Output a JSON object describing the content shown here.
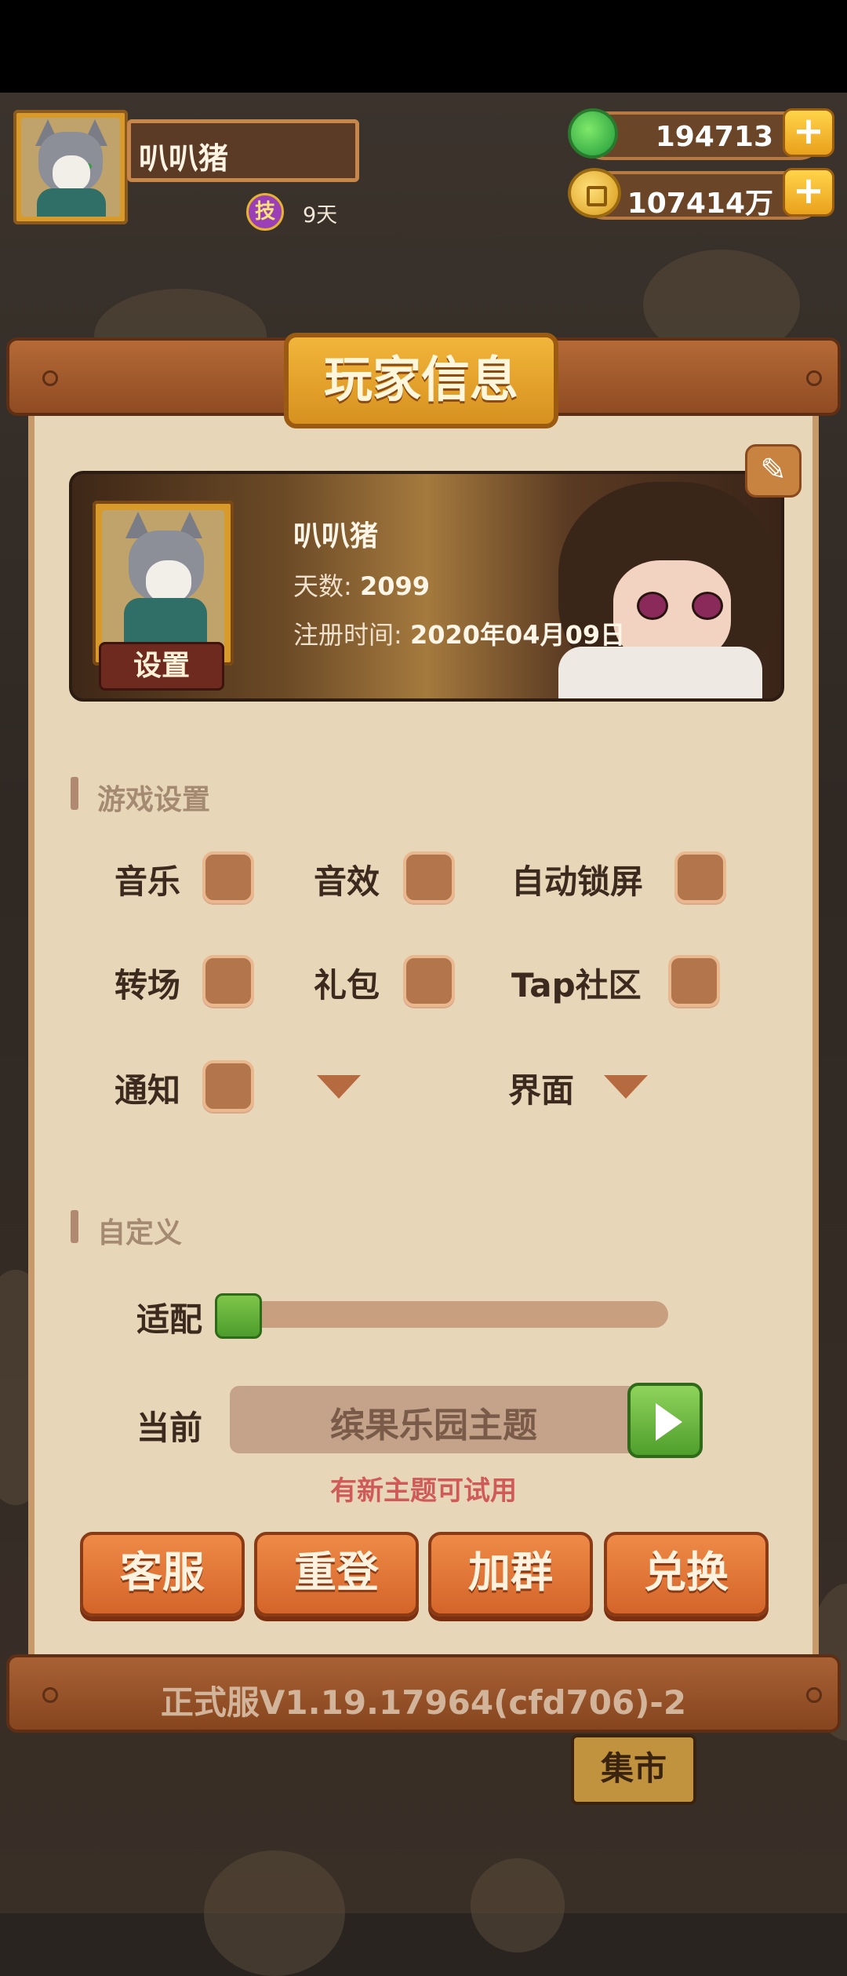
{
  "player": {
    "name": "叭叭猪",
    "skill_icon": "技",
    "skill_days": "9天"
  },
  "resources": {
    "jade": "194713",
    "coins": "107414万"
  },
  "panel": {
    "title": "玩家信息",
    "card": {
      "name": "叭叭猪",
      "days_label": "天数:",
      "days_value": "2099",
      "register_label": "注册时间:",
      "register_value": "2020年04月09日",
      "avatar_button": "设置"
    },
    "game_settings": {
      "title": "游戏设置",
      "options": [
        {
          "label": "音乐",
          "checked": false
        },
        {
          "label": "音效",
          "checked": false
        },
        {
          "label": "自动锁屏",
          "checked": false
        },
        {
          "label": "转场",
          "checked": false
        },
        {
          "label": "礼包",
          "checked": false
        },
        {
          "label": "Tap社区",
          "checked": false
        },
        {
          "label": "通知",
          "checked": false
        }
      ],
      "dropdown_label": "界面"
    },
    "custom": {
      "title": "自定义",
      "adapt_label": "适配",
      "adapt_value": 0,
      "current_label": "当前",
      "theme_name": "缤果乐园主题",
      "new_theme_hint": "有新主题可试用"
    },
    "buttons": [
      "客服",
      "重登",
      "加群",
      "兑换"
    ],
    "version": "正式服V1.19.17964(cfd706)-2"
  },
  "background": {
    "market_sign": "集市"
  },
  "colors": {
    "panel": "#e8d6b9",
    "wood": "#a86134",
    "button": "#e07a3a",
    "accent_green": "#5aa834",
    "hint": "#cf5a58"
  }
}
